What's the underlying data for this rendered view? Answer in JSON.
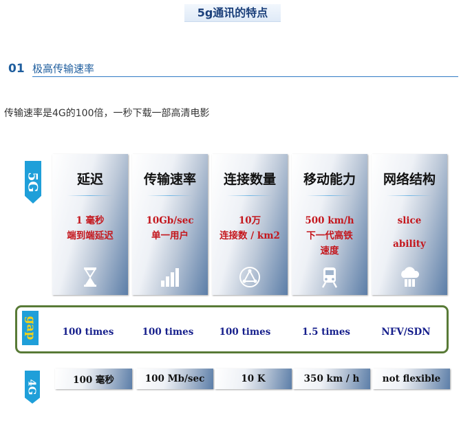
{
  "page_title": "5g通讯的特点",
  "section": {
    "number": "01",
    "label": "极高传输速率"
  },
  "intro": "传输速率是4G的100倍，一秒下载一部高清电影",
  "infographic": {
    "tag_5g": "5G",
    "tag_gap": "gap",
    "tag_4g": "4G",
    "cards": [
      {
        "title": "延迟",
        "lines": [
          "1 毫秒",
          "端到端延迟"
        ],
        "icon": "hourglass-icon"
      },
      {
        "title": "传输速率",
        "lines": [
          "10Gb/sec",
          "单一用户"
        ],
        "icon": "signal-bars-icon"
      },
      {
        "title": "连接数量",
        "lines": [
          "10万",
          "连接数 / km2"
        ],
        "icon": "network-nodes-icon"
      },
      {
        "title": "移动能力",
        "lines": [
          "500 km/h",
          "下一代高铁",
          "速度"
        ],
        "icon": "train-icon"
      },
      {
        "title": "网络结构",
        "lines": [
          "slice",
          "ability"
        ],
        "icon": "cloud-server-icon"
      }
    ],
    "gap": [
      "100 times",
      "100 times",
      "100 times",
      "1.5 times",
      "NFV/SDN"
    ],
    "g4": [
      "100 毫秒",
      "100 Mb/sec",
      "10 K",
      "350 km / h",
      "not flexible"
    ]
  },
  "colors": {
    "accent": "#1f5e9e",
    "tag": "#1f9fd9",
    "value_red": "#c4161c",
    "gap_border": "#587a36",
    "gap_text": "#17208c"
  }
}
